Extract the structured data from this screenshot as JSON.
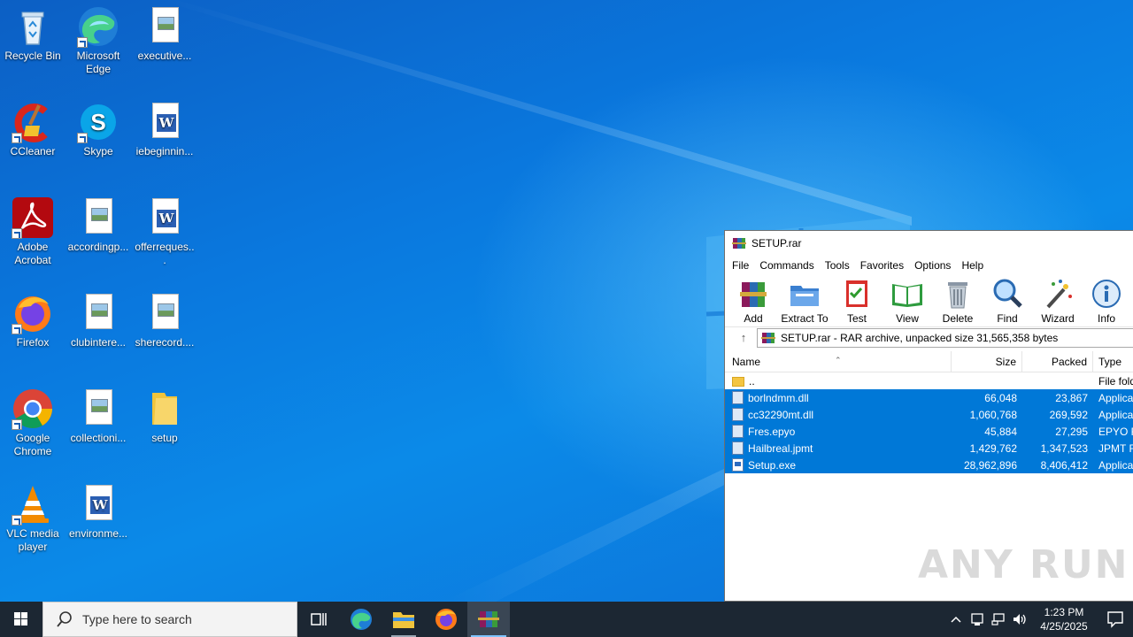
{
  "desktop": {
    "icons": [
      {
        "label": "Recycle Bin",
        "icon": "recycle-bin-icon"
      },
      {
        "label": "Microsoft Edge",
        "icon": "edge-icon"
      },
      {
        "label": "executive...",
        "icon": "image-file-icon"
      },
      {
        "label": "CCleaner",
        "icon": "ccleaner-icon"
      },
      {
        "label": "Skype",
        "icon": "skype-icon"
      },
      {
        "label": "iebeginnin...",
        "icon": "word-doc-icon"
      },
      {
        "label": "Adobe Acrobat",
        "icon": "acrobat-icon"
      },
      {
        "label": "accordingp...",
        "icon": "image-file-icon"
      },
      {
        "label": "offerreques...",
        "icon": "word-doc-icon"
      },
      {
        "label": "Firefox",
        "icon": "firefox-icon"
      },
      {
        "label": "clubintere...",
        "icon": "image-file-icon"
      },
      {
        "label": "sherecord....",
        "icon": "image-file-icon"
      },
      {
        "label": "Google Chrome",
        "icon": "chrome-icon"
      },
      {
        "label": "collectioni...",
        "icon": "image-file-icon"
      },
      {
        "label": "setup",
        "icon": "folder-icon"
      },
      {
        "label": "VLC media player",
        "icon": "vlc-icon"
      },
      {
        "label": "environme...",
        "icon": "word-doc-icon"
      }
    ]
  },
  "winrar": {
    "title": "SETUP.rar",
    "menu": [
      "File",
      "Commands",
      "Tools",
      "Favorites",
      "Options",
      "Help"
    ],
    "toolbar": [
      "Add",
      "Extract To",
      "Test",
      "View",
      "Delete",
      "Find",
      "Wizard",
      "Info"
    ],
    "address": "SETUP.rar - RAR archive, unpacked size 31,565,358 bytes",
    "columns": {
      "name": "Name",
      "size": "Size",
      "packed": "Packed",
      "type": "Type"
    },
    "rows": [
      {
        "name": "..",
        "size": "",
        "packed": "",
        "type": "File folder",
        "kind": "folder",
        "selected": false
      },
      {
        "name": "borlndmm.dll",
        "size": "66,048",
        "packed": "23,867",
        "type": "Application extension",
        "kind": "file",
        "selected": true
      },
      {
        "name": "cc32290mt.dll",
        "size": "1,060,768",
        "packed": "269,592",
        "type": "Application extension",
        "kind": "file",
        "selected": true
      },
      {
        "name": "Fres.epyo",
        "size": "45,884",
        "packed": "27,295",
        "type": "EPYO File",
        "kind": "file",
        "selected": true
      },
      {
        "name": "Hailbreal.jpmt",
        "size": "1,429,762",
        "packed": "1,347,523",
        "type": "JPMT File",
        "kind": "file",
        "selected": true
      },
      {
        "name": "Setup.exe",
        "size": "28,962,896",
        "packed": "8,406,412",
        "type": "Application",
        "kind": "exe",
        "selected": true
      }
    ],
    "watermark": "ANY RUN"
  },
  "taskbar": {
    "search_placeholder": "Type here to search",
    "apps": [
      "task-view-icon",
      "edge-icon",
      "file-explorer-icon",
      "firefox-icon",
      "winrar-icon"
    ],
    "time": "1:23 PM",
    "date": "4/25/2025"
  },
  "colors": {
    "selection": "#0078d7",
    "taskbar": "#1c2733",
    "wallpaper": "#0a78de"
  }
}
